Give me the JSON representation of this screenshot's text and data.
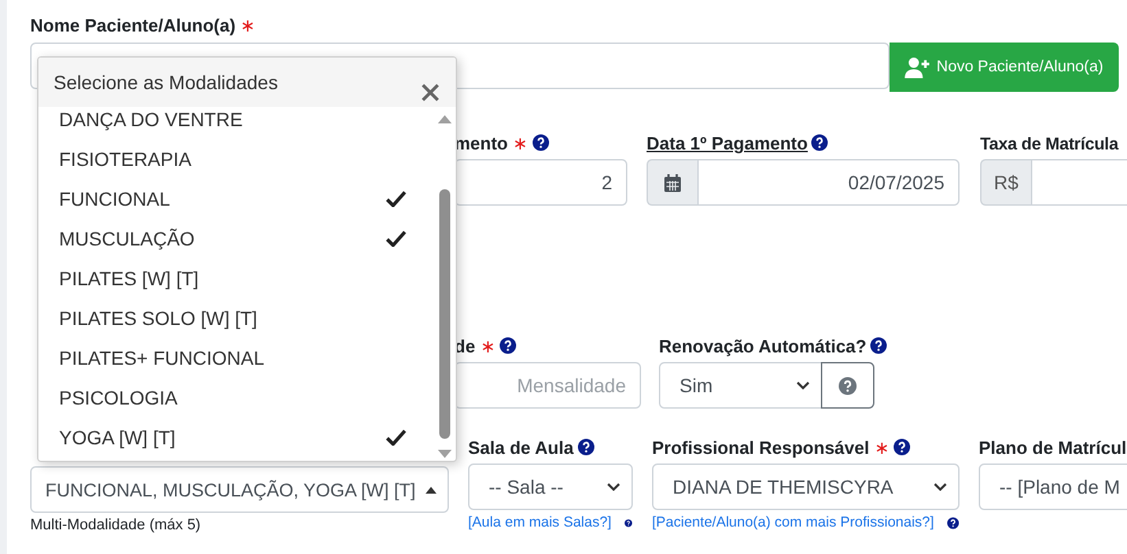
{
  "patient_field": {
    "label": "Nome Paciente/Aluno(a)",
    "required_mark": "∗",
    "new_button": "Novo Paciente/Aluno(a)"
  },
  "row_payment": [
    {
      "kind": "number",
      "label": "mento",
      "required_mark": "∗",
      "help": true,
      "value": "2"
    },
    {
      "kind": "date",
      "label": "Data 1º Pagamento",
      "underlined": true,
      "help": true,
      "value": "02/07/2025"
    },
    {
      "kind": "addon",
      "label": "Taxa de Matrícula",
      "addon": "R$"
    }
  ],
  "row_renewal": [
    {
      "kind": "number",
      "label": "de",
      "required_mark": "∗",
      "help": true,
      "placeholder": "Mensalidade"
    },
    {
      "kind": "select_button",
      "label": "Renovação Automática?",
      "help": true,
      "value": "Sim"
    }
  ],
  "modalities_field": {
    "value": "FUNCIONAL, MUSCULAÇÃO, YOGA [W] [T]",
    "expanded": true,
    "help_text": "Multi-Modalidade (máx 5)"
  },
  "row_class": [
    {
      "kind": "select",
      "label": "Sala de Aula",
      "help": true,
      "value": "-- Sala --",
      "link": "[Aula em mais Salas?]"
    },
    {
      "kind": "select",
      "label": "Profissional Responsável",
      "required_mark": "∗",
      "help": true,
      "value": "DIANA DE THEMISCYRA",
      "link": "[Paciente/Aluno(a) com mais Profissionais?]"
    },
    {
      "kind": "cut_select",
      "label": "Plano de Matrícul",
      "value": "-- [Plano de M"
    }
  ],
  "modalities_popup": {
    "title": "Selecione as Modalidades",
    "items": [
      {
        "label": "DANÇA DO VENTRE",
        "checked": false
      },
      {
        "label": "FISIOTERAPIA",
        "checked": false
      },
      {
        "label": "FUNCIONAL",
        "checked": true
      },
      {
        "label": "MUSCULAÇÃO",
        "checked": true
      },
      {
        "label": "PILATES [W] [T]",
        "checked": false
      },
      {
        "label": "PILATES SOLO [W] [T]",
        "checked": false
      },
      {
        "label": "PILATES+ FUNCIONAL",
        "checked": false
      },
      {
        "label": "PSICOLOGIA",
        "checked": false
      },
      {
        "label": "YOGA [W] [T]",
        "checked": true
      }
    ]
  }
}
